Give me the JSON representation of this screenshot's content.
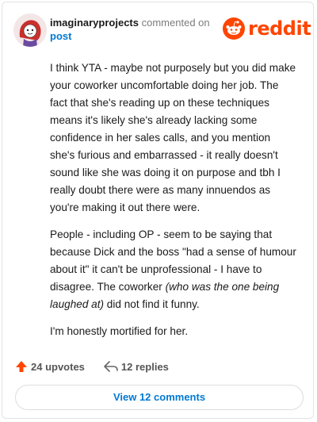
{
  "comment": {
    "username": "imaginaryprojects",
    "action": "commented on",
    "target": "post",
    "paragraphs": [
      {
        "text": "I think YTA - maybe not purposely but you did make your coworker uncomfortable doing her job. The fact that she's reading up on these techniques means it's likely she's already lacking some confidence in her sales calls, and you mention she's furious and embarrassed - it really doesn't sound like she was doing it on purpose and tbh I really doubt there were as many innuendos as you're making it out there were."
      },
      {
        "pre": "People - including OP - seem to be saying that because Dick and the boss \"had a sense of humour about it\" it can't be unprofessional - I have to disagree. The coworker ",
        "em": "(who was the one being laughed at)",
        "post": " did not find it funny."
      },
      {
        "text": "I'm honestly mortified for her."
      }
    ]
  },
  "brand": {
    "wordmark": "reddit",
    "color": "#ff4500"
  },
  "stats": {
    "upvotes": "24 upvotes",
    "replies": "12 replies"
  },
  "actions": {
    "view_comments": "View 12 comments"
  },
  "icons": [
    "avatar",
    "reddit-logo-icon",
    "upvote-arrow-icon",
    "reply-arrow-icon"
  ]
}
